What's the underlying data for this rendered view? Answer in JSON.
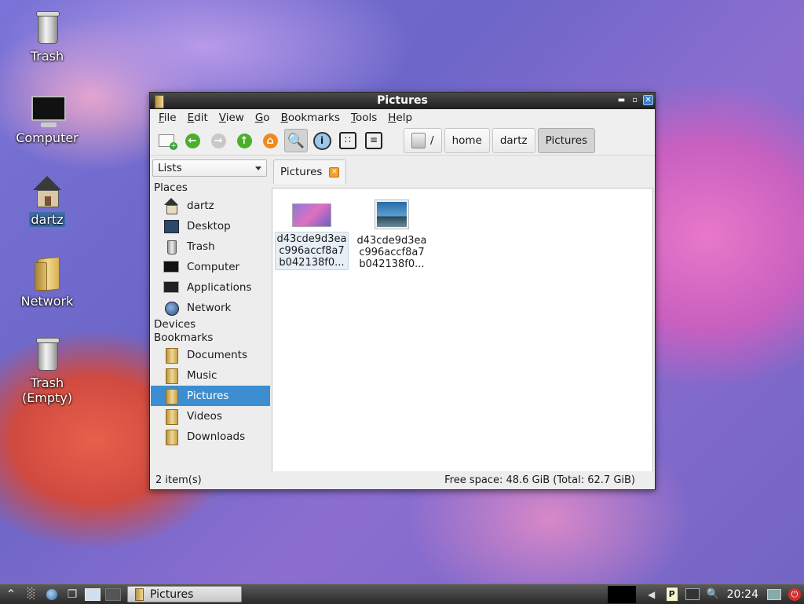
{
  "desktop": {
    "icons": [
      {
        "label": "Trash",
        "icon": "trash-icon"
      },
      {
        "label": "Computer",
        "icon": "computer-icon"
      },
      {
        "label": "dartz",
        "icon": "home-icon"
      },
      {
        "label": "Network",
        "icon": "network-folder-icon"
      },
      {
        "label": "Trash\n(Empty)",
        "icon": "trash-empty-icon"
      }
    ]
  },
  "window": {
    "title": "Pictures",
    "menu": {
      "file": {
        "u": "F",
        "rest": "ile"
      },
      "edit": {
        "u": "E",
        "rest": "dit"
      },
      "view": {
        "u": "V",
        "rest": "iew"
      },
      "go": {
        "u": "G",
        "rest": "o"
      },
      "bookmarks": {
        "u": "B",
        "rest": "ookmarks"
      },
      "tools": {
        "u": "T",
        "rest": "ools"
      },
      "help": {
        "u": "H",
        "rest": "elp"
      }
    },
    "breadcrumb": [
      "/",
      "home",
      "dartz",
      "Pictures"
    ],
    "sidepane": {
      "selector": "Lists",
      "places_header": "Places",
      "places": [
        "dartz",
        "Desktop",
        "Trash",
        "Computer",
        "Applications",
        "Network"
      ],
      "devices_header": "Devices",
      "bookmarks_header": "Bookmarks",
      "bookmarks": [
        "Documents",
        "Music",
        "Pictures",
        "Videos",
        "Downloads"
      ]
    },
    "tab": {
      "label": "Pictures"
    },
    "files": [
      {
        "name": "d43cde9d3ea\nc996accf8a7\nb042138f0..."
      },
      {
        "name": "d43cde9d3ea\nc996accf8a7\nb042138f0..."
      }
    ],
    "status": {
      "items": "2 item(s)",
      "free": "Free space: 48.6 GiB (Total: 62.7 GiB)"
    }
  },
  "taskbar": {
    "task": "Pictures",
    "clock": "20:24"
  },
  "colors": {
    "selection": "#3d8ed0",
    "titlebar": "#2a2a2a",
    "close_button": "#3a7ec8"
  }
}
